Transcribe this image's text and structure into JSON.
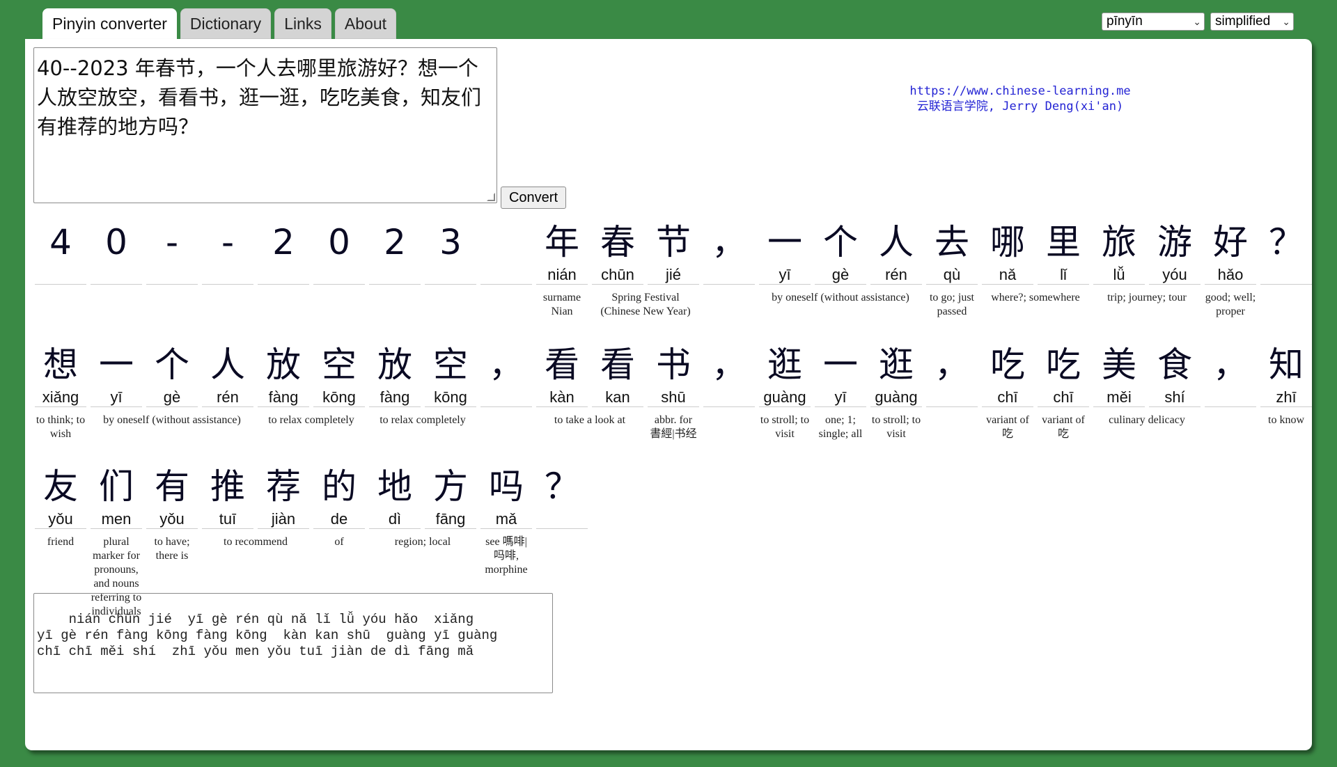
{
  "tabs": [
    "Pinyin converter",
    "Dictionary",
    "Links",
    "About"
  ],
  "controls": {
    "romanization": "pīnyīn",
    "charset": "simplified",
    "convert_label": "Convert"
  },
  "input": {
    "text": "40--2023 年春节，一个人去哪里旅游好？想一个人放空放空，看看书，逛一逛，吃吃美食，知友们有推荐的地方吗？"
  },
  "credits": {
    "url": "https://www.chinese-learning.me",
    "author": "云联语言学院, Jerry Deng(xi'an)"
  },
  "rows": [
    {
      "chars": [
        {
          "h": "4",
          "p": ""
        },
        {
          "h": "0",
          "p": ""
        },
        {
          "h": "-",
          "p": ""
        },
        {
          "h": "-",
          "p": ""
        },
        {
          "h": "2",
          "p": ""
        },
        {
          "h": "0",
          "p": ""
        },
        {
          "h": "2",
          "p": ""
        },
        {
          "h": "3",
          "p": ""
        },
        {
          "h": "",
          "p": ""
        },
        {
          "h": "年",
          "p": "nián"
        },
        {
          "h": "春",
          "p": "chūn"
        },
        {
          "h": "节",
          "p": "jié"
        },
        {
          "h": "，",
          "p": ""
        },
        {
          "h": "一",
          "p": "yī"
        },
        {
          "h": "个",
          "p": "gè"
        },
        {
          "h": "人",
          "p": "rén"
        },
        {
          "h": "去",
          "p": "qù"
        },
        {
          "h": "哪",
          "p": "nǎ"
        },
        {
          "h": "里",
          "p": "lǐ"
        },
        {
          "h": "旅",
          "p": "lǚ"
        },
        {
          "h": "游",
          "p": "yóu"
        },
        {
          "h": "好",
          "p": "hǎo"
        },
        {
          "h": "？",
          "p": ""
        }
      ],
      "glosses": [
        {
          "start": 9,
          "span": 1,
          "t": "surname Nian"
        },
        {
          "start": 10,
          "span": 2,
          "t": "Spring Festival (Chinese New Year)"
        },
        {
          "start": 13,
          "span": 3,
          "t": "by oneself (without assistance)"
        },
        {
          "start": 16,
          "span": 1,
          "t": "to go; just passed"
        },
        {
          "start": 17,
          "span": 2,
          "t": "where?; somewhere"
        },
        {
          "start": 19,
          "span": 2,
          "t": "trip; journey; tour"
        },
        {
          "start": 21,
          "span": 1,
          "t": "good; well; proper"
        }
      ]
    },
    {
      "chars": [
        {
          "h": "想",
          "p": "xiǎng"
        },
        {
          "h": "一",
          "p": "yī"
        },
        {
          "h": "个",
          "p": "gè"
        },
        {
          "h": "人",
          "p": "rén"
        },
        {
          "h": "放",
          "p": "fàng"
        },
        {
          "h": "空",
          "p": "kōng"
        },
        {
          "h": "放",
          "p": "fàng"
        },
        {
          "h": "空",
          "p": "kōng"
        },
        {
          "h": "，",
          "p": ""
        },
        {
          "h": "看",
          "p": "kàn"
        },
        {
          "h": "看",
          "p": "kan"
        },
        {
          "h": "书",
          "p": "shū"
        },
        {
          "h": "，",
          "p": ""
        },
        {
          "h": "逛",
          "p": "guàng"
        },
        {
          "h": "一",
          "p": "yī"
        },
        {
          "h": "逛",
          "p": "guàng"
        },
        {
          "h": "，",
          "p": ""
        },
        {
          "h": "吃",
          "p": "chī"
        },
        {
          "h": "吃",
          "p": "chī"
        },
        {
          "h": "美",
          "p": "měi"
        },
        {
          "h": "食",
          "p": "shí"
        },
        {
          "h": "，",
          "p": ""
        },
        {
          "h": "知",
          "p": "zhī"
        }
      ],
      "glosses": [
        {
          "start": 0,
          "span": 1,
          "t": "to think; to wish"
        },
        {
          "start": 1,
          "span": 3,
          "t": "by oneself (without assistance)"
        },
        {
          "start": 4,
          "span": 2,
          "t": "to relax completely"
        },
        {
          "start": 6,
          "span": 2,
          "t": "to relax completely"
        },
        {
          "start": 9,
          "span": 2,
          "t": "to take a look at"
        },
        {
          "start": 11,
          "span": 1,
          "t": "abbr. for 書經|书经"
        },
        {
          "start": 13,
          "span": 1,
          "t": "to stroll; to visit"
        },
        {
          "start": 14,
          "span": 1,
          "t": "one; 1; single; all"
        },
        {
          "start": 15,
          "span": 1,
          "t": "to stroll; to visit"
        },
        {
          "start": 17,
          "span": 1,
          "t": "variant of 吃"
        },
        {
          "start": 18,
          "span": 1,
          "t": "variant of 吃"
        },
        {
          "start": 19,
          "span": 2,
          "t": "culinary delicacy"
        },
        {
          "start": 22,
          "span": 1,
          "t": "to know"
        }
      ]
    },
    {
      "chars": [
        {
          "h": "友",
          "p": "yǒu"
        },
        {
          "h": "们",
          "p": "men"
        },
        {
          "h": "有",
          "p": "yǒu"
        },
        {
          "h": "推",
          "p": "tuī"
        },
        {
          "h": "荐",
          "p": "jiàn"
        },
        {
          "h": "的",
          "p": "de"
        },
        {
          "h": "地",
          "p": "dì"
        },
        {
          "h": "方",
          "p": "fāng"
        },
        {
          "h": "吗",
          "p": "mǎ"
        },
        {
          "h": "？",
          "p": ""
        }
      ],
      "glosses": [
        {
          "start": 0,
          "span": 1,
          "t": "friend"
        },
        {
          "start": 1,
          "span": 1,
          "t": "plural marker for pronouns, and nouns referring to individuals"
        },
        {
          "start": 2,
          "span": 1,
          "t": "to have; there is"
        },
        {
          "start": 3,
          "span": 2,
          "t": "to recommend"
        },
        {
          "start": 5,
          "span": 1,
          "t": "of"
        },
        {
          "start": 6,
          "span": 2,
          "t": "region; local"
        },
        {
          "start": 8,
          "span": 1,
          "t": "see 嗎啡|吗啡, morphine"
        }
      ]
    }
  ],
  "output": {
    "text": "  nián chūn jié  yī gè rén qù nǎ lǐ lǚ yóu hǎo  xiǎng\nyī gè rén fàng kōng fàng kōng  kàn kan shū  guàng yī guàng\nchī chī měi shí  zhī yǒu men yǒu tuī jiàn de dì fāng mǎ"
  }
}
